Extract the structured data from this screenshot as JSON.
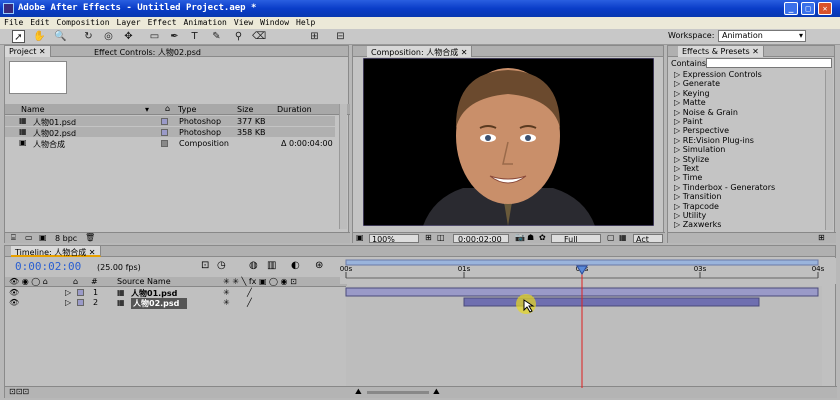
{
  "window": {
    "title": "Adobe After Effects - Untitled Project.aep *"
  },
  "menu": [
    "File",
    "Edit",
    "Composition",
    "Layer",
    "Effect",
    "Animation",
    "View",
    "Window",
    "Help"
  ],
  "workspace": {
    "label": "Workspace:",
    "value": "Animation"
  },
  "project_panel": {
    "tab_project": "Project",
    "tab_effect_controls": "Effect Controls: 人物02.psd",
    "columns": [
      "Name",
      "Type",
      "Size",
      "Duration"
    ],
    "rows": [
      {
        "name": "人物01.psd",
        "type": "Photoshop",
        "size": "377 KB",
        "duration": ""
      },
      {
        "name": "人物02.psd",
        "type": "Photoshop",
        "size": "358 KB",
        "duration": ""
      },
      {
        "name": "人物合成",
        "type": "Composition",
        "size": "",
        "duration": "Δ 0:00:04:00"
      }
    ],
    "bpc": "8 bpc"
  },
  "comp_panel": {
    "tab": "Composition: 人物合成",
    "zoom": "100%",
    "timecode": "0:00:02:00",
    "resolution": "Full",
    "active_camera": "Act"
  },
  "effects_panel": {
    "tab": "Effects & Presets",
    "contains_label": "Contains:",
    "contains_value": "",
    "items": [
      "Expression Controls",
      "Generate",
      "Keying",
      "Matte",
      "Noise & Grain",
      "Paint",
      "Perspective",
      "RE:Vision Plug-ins",
      "Simulation",
      "Stylize",
      "Text",
      "Time",
      "Tinderbox - Generators",
      "Transition",
      "Trapcode",
      "Utility",
      "Zaxwerks"
    ]
  },
  "timeline": {
    "tab": "Timeline: 人物合成",
    "timecode": "0:00:02:00",
    "fps": "(25.00 fps)",
    "col_num": "#",
    "col_source": "Source Name",
    "ruler": [
      "00s",
      "01s",
      "02s",
      "03s",
      "04s"
    ],
    "layers": [
      {
        "num": "1",
        "name": "人物01.psd",
        "start": 0,
        "end": 4
      },
      {
        "num": "2",
        "name": "人物02.psd",
        "start": 1,
        "end": 3.5
      }
    ],
    "current_time": 2
  }
}
